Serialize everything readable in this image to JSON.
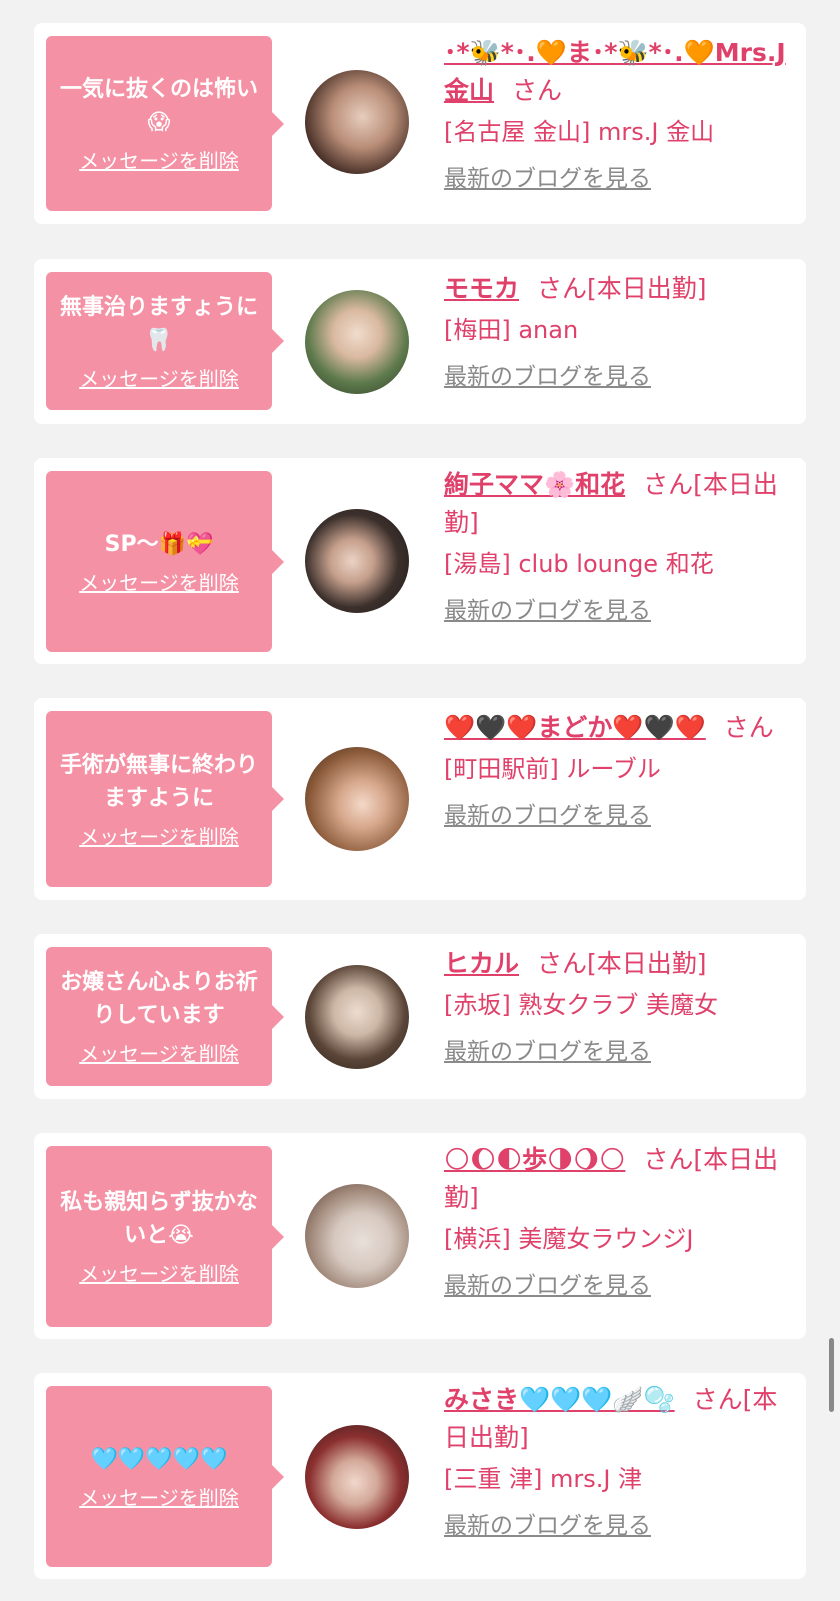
{
  "delete_label": "メッセージを削除",
  "san_label": "さん",
  "blog_label": "最新のブログを見る",
  "entries": [
    {
      "message": "一気に抜くのは怖い😱",
      "name": "･*🐝*･.🧡ま･*🐝*･.🧡Mrs.J金山",
      "suffix": "",
      "shop": "[名古屋 金山] mrs.J 金山"
    },
    {
      "message": "無事治りますょうに🦷",
      "name": "モモカ",
      "suffix": "[本日出勤]",
      "shop": "[梅田] anan"
    },
    {
      "message": "SP～🎁💝",
      "name": "絢子ママ🌸和花",
      "suffix": "[本日出勤]",
      "shop": "[湯島] club lounge 和花"
    },
    {
      "message": "手術が無事に終わりますように",
      "name": "❤️🖤❤️まどか❤️🖤❤️",
      "suffix": "",
      "shop": "[町田駅前] ルーブル"
    },
    {
      "message": "お嬢さん心よりお祈りしています",
      "name": "ヒカル",
      "suffix": "[本日出勤]",
      "shop": "[赤坂] 熟女クラブ 美魔女"
    },
    {
      "message": "私も親知らず抜かないと😭",
      "name": "🌕🌔🌓歩🌗🌖🌕",
      "suffix": "[本日出勤]",
      "shop": "[横浜] 美魔女ラウンジJ"
    },
    {
      "message": "🩵🩵🩵🩵🩵",
      "name": "みさき🩵🩵🩵🪽🫧",
      "suffix": "[本日出勤]",
      "shop": "[三重 津] mrs.J 津"
    }
  ],
  "colors": {
    "accent": "#e0416a",
    "bubble": "#f591a4",
    "link_gray": "#8a8a8a",
    "background": "#f2f2f2"
  }
}
